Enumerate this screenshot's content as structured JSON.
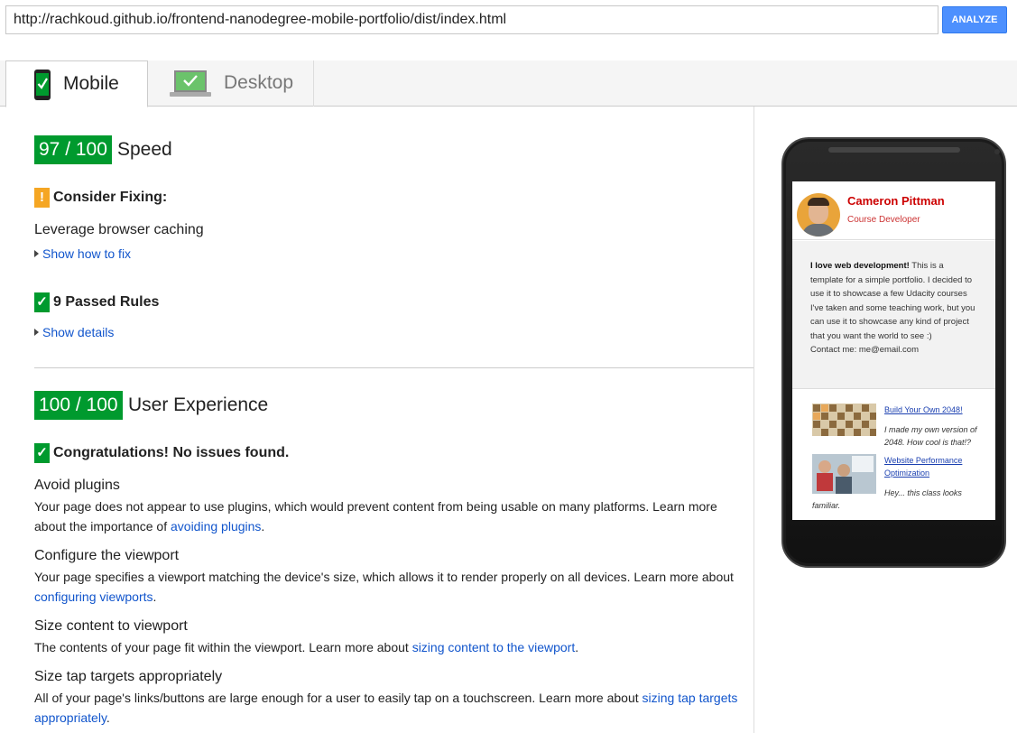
{
  "url_bar": {
    "value": "http://rachkoud.github.io/frontend-nanodegree-mobile-portfolio/dist/index.html"
  },
  "analyze_button": "ANALYZE",
  "tabs": [
    {
      "label": "Mobile",
      "active": true
    },
    {
      "label": "Desktop",
      "active": false
    }
  ],
  "speed": {
    "score": "97 / 100",
    "label": "Speed",
    "consider_fixing": "Consider Fixing:",
    "rule": "Leverage browser caching",
    "show_fix": "Show how to fix",
    "passed": "9 Passed Rules",
    "show_details": "Show details"
  },
  "ux": {
    "score": "100 / 100",
    "label": "User Experience",
    "congrats": "Congratulations! No issues found.",
    "rules": [
      {
        "title": "Avoid plugins",
        "text": "Your page does not appear to use plugins, which would prevent content from being usable on many platforms. Learn more about the importance of ",
        "link": "avoiding plugins",
        "end": "."
      },
      {
        "title": "Configure the viewport",
        "text": "Your page specifies a viewport matching the device's size, which allows it to render properly on all devices. Learn more about ",
        "link": "configuring viewports",
        "end": "."
      },
      {
        "title": "Size content to viewport",
        "text": "The contents of your page fit within the viewport. Learn more about ",
        "link": "sizing content to the viewport",
        "end": "."
      },
      {
        "title": "Size tap targets appropriately",
        "text": "All of your page's links/buttons are large enough for a user to easily tap on a touchscreen. Learn more about ",
        "link": "sizing tap targets appropriately",
        "end": "."
      }
    ]
  },
  "preview": {
    "name": "Cameron Pittman",
    "role": "Course Developer",
    "bio_bold": "I love web development!",
    "bio_text": " This is a template for a simple portfolio. I decided to use it to showcase a few Udacity courses I've taken and some teaching work, but you can use it to showcase any kind of project that you want the world to see :)",
    "contact": "Contact me: me@email.com",
    "projects": [
      {
        "title": "Build Your Own 2048!",
        "desc": "I made my own version of 2048. How cool is that!?"
      },
      {
        "title": "Website Performance Optimization",
        "desc": "Hey... this class looks familiar."
      }
    ]
  },
  "colors": {
    "score_green": "#009a2e",
    "warn_orange": "#f5a623",
    "link_blue": "#1155cc",
    "button_blue": "#4d90fe"
  }
}
